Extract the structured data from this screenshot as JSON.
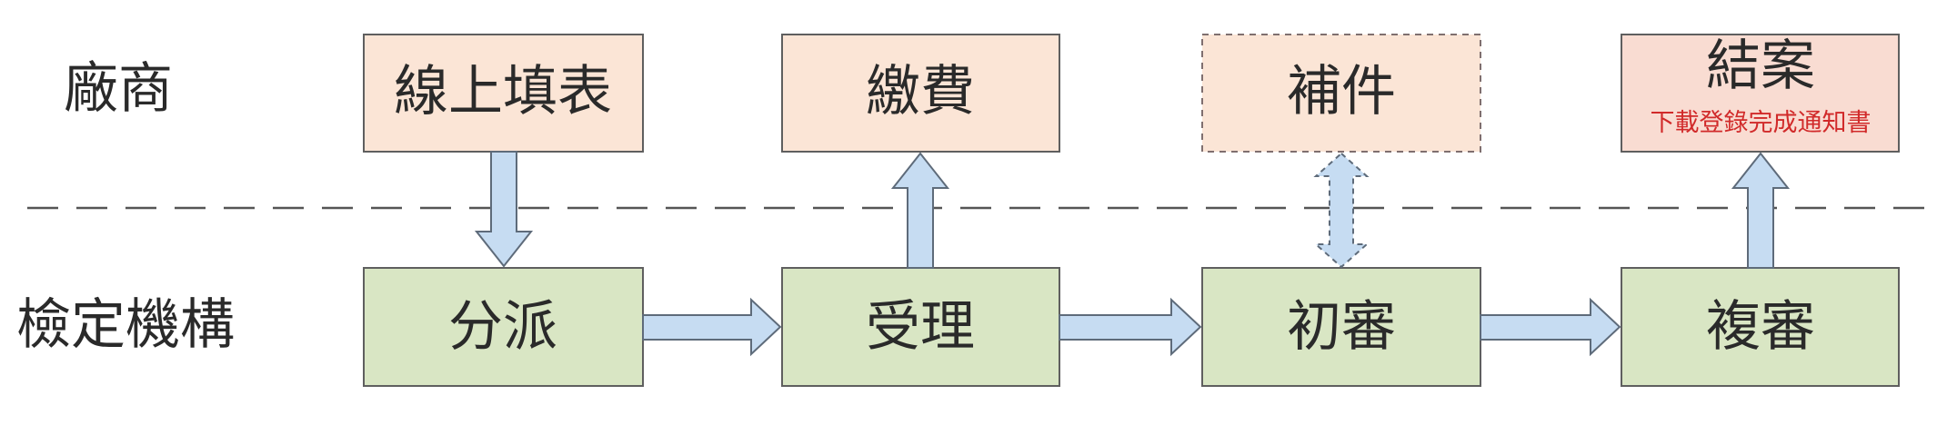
{
  "lanes": {
    "vendor": "廠商",
    "agency": "檢定機構"
  },
  "vendor_steps": {
    "online_form": "線上填表",
    "payment": "繳費",
    "supplement": "補件",
    "close_case": "結案",
    "close_case_note": "下載登錄完成通知書"
  },
  "agency_steps": {
    "dispatch": "分派",
    "accept": "受理",
    "first_review": "初審",
    "second_review": "複審"
  },
  "colors": {
    "vendor_box": "#fbe5d6",
    "agency_box": "#d9e6c4",
    "arrow_fill": "#c6dcf2",
    "note_text": "#d12a2a"
  }
}
